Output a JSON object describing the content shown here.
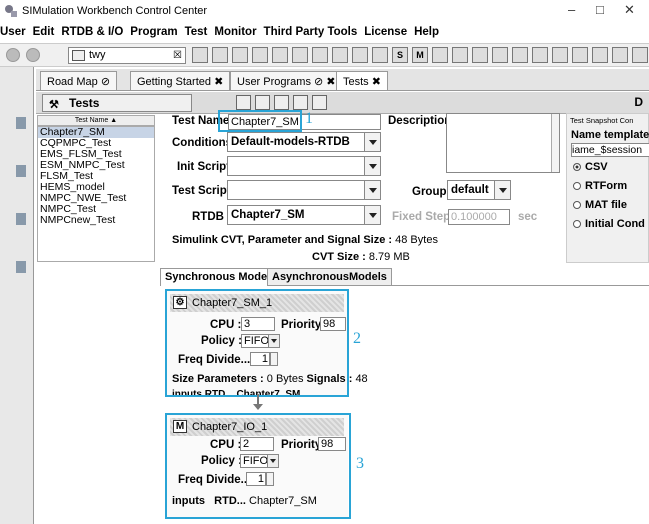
{
  "window": {
    "title": "SIMulation Workbench Control Center",
    "controls": {
      "minimize": "–",
      "maximize": "□",
      "close": "✕"
    }
  },
  "menu": [
    "User",
    "Edit",
    "RTDB & I/O",
    "Program",
    "Test",
    "Monitor",
    "Third Party Tools",
    "License",
    "Help"
  ],
  "toolbar": {
    "combo_value": "twy",
    "combo_close": "☒",
    "icon_labels": [
      "",
      "",
      "",
      "",
      "",
      "",
      "",
      "",
      "",
      "",
      "S",
      "M"
    ]
  },
  "tabs": [
    {
      "label": "Road Map",
      "suffix": "⊘"
    },
    {
      "label": "Getting Started",
      "suffix": "✖"
    },
    {
      "label": "User Programs",
      "suffix": "⊘ ✖"
    },
    {
      "label": "Tests",
      "suffix": "✖"
    }
  ],
  "tests_panel": {
    "title": "Tests",
    "right_label": "D",
    "list_header": "Test Name ▲",
    "list_items": [
      "Chapter7_SM",
      "CQPMPC_Test",
      "EMS_FLSM_Test",
      "ESM_NMPC_Test",
      "FLSM_Test",
      "HEMS_model",
      "NMPC_NWE_Test",
      "NMPC_Test",
      "NMPCnew_Test"
    ]
  },
  "form": {
    "test_name_label": "Test Name :",
    "test_name_value": "Chapter7_SM",
    "description_label": "Description :",
    "conditions_label": "Conditions :",
    "conditions_value": "Default-models-RTDB",
    "init_script_label": "Init Script :",
    "test_script_label": "Test Script :",
    "group_label": "Group :",
    "group_value": "default",
    "rtdb_label": "RTDB :",
    "rtdb_value": "Chapter7_SM",
    "fixed_step_label": "Fixed Step :",
    "fixed_step_value": "0.100000",
    "fixed_step_unit": "sec",
    "cvt_label": "Simulink CVT, Parameter and Signal Size :",
    "cvt_value": "48 Bytes",
    "cvt_size_label": "CVT Size :",
    "cvt_size_value": "8.79 MB"
  },
  "snapshot": {
    "title": "Test Snapshot Con",
    "name_template_label": "Name template",
    "name_template_value": "iame_$session",
    "options": [
      "CSV",
      "RTForm",
      "MAT file",
      "Initial Cond"
    ],
    "selected": "CSV"
  },
  "model_tabs": [
    "Synchronous Models",
    "AsynchronousModels"
  ],
  "models": [
    {
      "name": "Chapter7_SM_1",
      "icon": "simulink-model-icon",
      "cpu_label": "CPU :",
      "cpu": "3",
      "priority_label": "Priority :",
      "priority": "98",
      "policy_label": "Policy :",
      "policy": "FIFO",
      "freq_label": "Freq Divide...",
      "freq": "1",
      "size_label": "Size Parameters :",
      "size_value": "0 Bytes",
      "signals_label": "Signals :",
      "signals_value": "48",
      "inputs_row": "inputs    RTD...   Chapter7_SM"
    },
    {
      "name": "Chapter7_IO_1",
      "icon": "matlab-m-icon",
      "cpu_label": "CPU :",
      "cpu": "2",
      "priority_label": "Priority :",
      "priority": "98",
      "policy_label": "Policy :",
      "policy": "FIFO",
      "freq_label": "Freq Divide...",
      "freq": "1",
      "inputs_label": "inputs",
      "rtd_label": "RTD...",
      "rtd_value": "Chapter7_SM"
    }
  ],
  "callouts": [
    "1",
    "2",
    "3"
  ],
  "colors": {
    "callout": "#29a4d6",
    "selection": "#c7d4e6"
  }
}
